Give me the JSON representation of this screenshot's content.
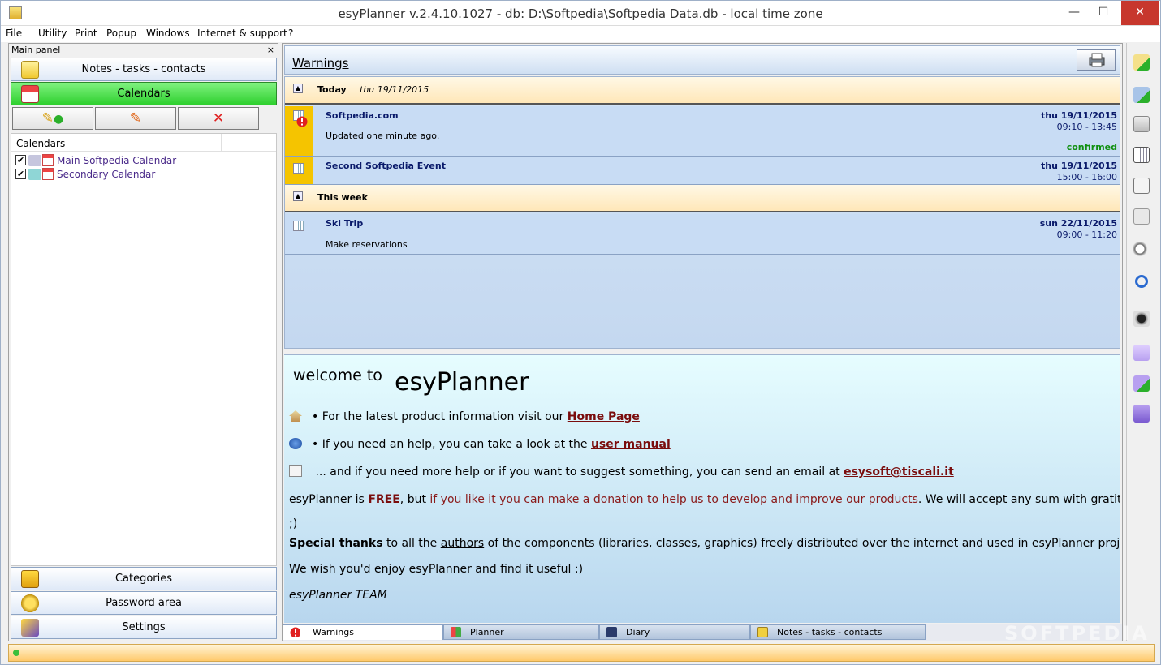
{
  "window": {
    "title": "esyPlanner v.2.4.10.1027 - db: D:\\Softpedia\\Softpedia Data.db - local time zone"
  },
  "menu": [
    "File",
    "Utility",
    "Print",
    "Popup",
    "Windows",
    "Internet & support",
    "?"
  ],
  "left_panel": {
    "header": "Main panel",
    "close": "×",
    "nav_top": [
      "Notes - tasks - contacts",
      "Calendars"
    ],
    "tools": {
      "add": "✎",
      "edit": "✎",
      "delete": "✕"
    },
    "calendars_header": "Calendars",
    "calendars": [
      {
        "label": "Main Softpedia Calendar",
        "checked": "✔",
        "color": "#c6c6de"
      },
      {
        "label": "Secondary Calendar",
        "checked": "✔",
        "color": "#8fd6d6"
      }
    ],
    "nav_bottom": [
      "Categories",
      "Password area",
      "Settings"
    ]
  },
  "warnings": {
    "title": "Warnings",
    "groups": [
      {
        "label": "Today",
        "date": "thu 19/11/2015"
      },
      {
        "label": "This week",
        "date": ""
      }
    ],
    "events": [
      {
        "name": "Softpedia.com",
        "desc": "Updated one minute ago.",
        "date": "thu 19/11/2015",
        "time": "09:10 - 13:45",
        "status": "confirmed"
      },
      {
        "name": "Second Softpedia Event",
        "desc": "",
        "date": "thu 19/11/2015",
        "time": "15:00 - 16:00",
        "status": ""
      },
      {
        "name": "Ski Trip",
        "desc": "Make reservations",
        "date": "sun 22/11/2015",
        "time": "09:00 - 11:20",
        "status": ""
      }
    ]
  },
  "welcome": {
    "prefix": "welcome to",
    "app": "esyPlanner",
    "line1": {
      "text": "• For the latest product information visit our ",
      "link": "Home Page"
    },
    "line2": {
      "text": "• If you need an help, you can take a look at the ",
      "link": "user manual"
    },
    "line3": {
      "text": " ... and if you need more help or if you want to suggest something, you can send an email at ",
      "link": "esysoft@tiscali.it"
    },
    "donate": {
      "pre": "esyPlanner is ",
      "free": "FREE",
      "mid": ", but ",
      "link": "if you like it you can make a donation to help us to develop and improve our products",
      "post": ". We will accept any sum with gratitude"
    },
    "smiley": ";)",
    "thanks": {
      "bold": "Special thanks",
      "pre": " to all the ",
      "link": "authors",
      "post": " of the components (libraries, classes, graphics) freely distributed over the internet and used in esyPlanner project."
    },
    "wish": "We wish you'd enjoy esyPlanner and find it useful :)",
    "team": "esyPlanner TEAM"
  },
  "tabs": [
    "Warnings",
    "Planner",
    "Diary",
    "Notes - tasks - contacts"
  ],
  "watermark": "SOFTPEDIA",
  "window_controls": {
    "min": "—",
    "max": "☐",
    "close": "✕"
  }
}
